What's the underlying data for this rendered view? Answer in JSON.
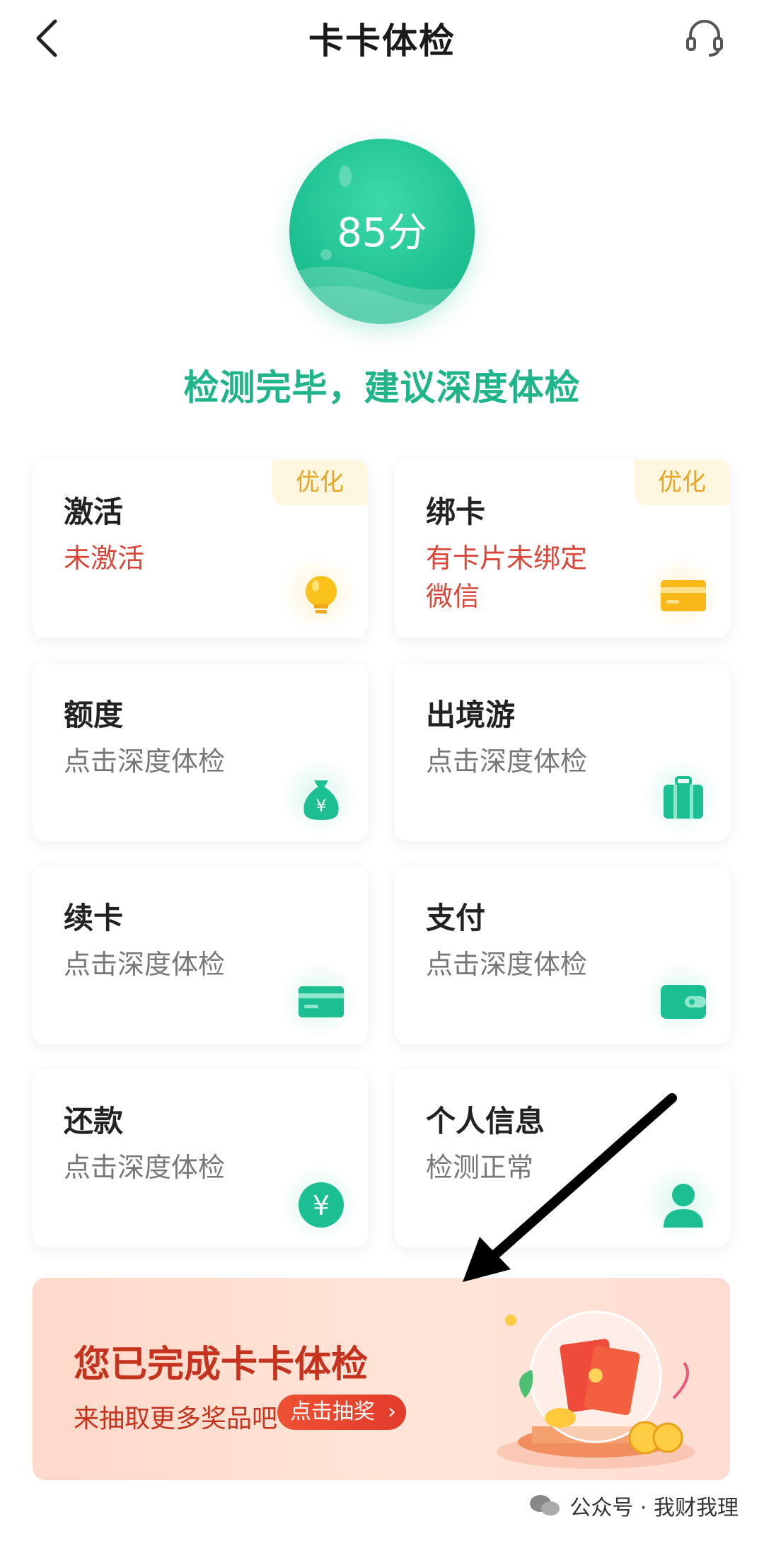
{
  "header": {
    "title": "卡卡体检"
  },
  "score": {
    "text": "85分"
  },
  "status": {
    "message": "检测完毕，建议深度体检"
  },
  "cards": [
    {
      "title": "激活",
      "subtitle": "未激活",
      "badge": "优化",
      "icon": "lightbulb-icon"
    },
    {
      "title": "绑卡",
      "subtitle": "有卡片未绑定微信",
      "badge": "优化",
      "icon": "card-icon"
    },
    {
      "title": "额度",
      "subtitle": "点击深度体检",
      "icon": "money-bag-icon"
    },
    {
      "title": "出境游",
      "subtitle": "点击深度体检",
      "icon": "suitcase-icon"
    },
    {
      "title": "续卡",
      "subtitle": "点击深度体检",
      "icon": "card-icon"
    },
    {
      "title": "支付",
      "subtitle": "点击深度体检",
      "icon": "wallet-icon"
    },
    {
      "title": "还款",
      "subtitle": "点击深度体检",
      "icon": "yuan-coin-icon"
    },
    {
      "title": "个人信息",
      "subtitle": "检测正常",
      "icon": "person-icon"
    }
  ],
  "banner": {
    "title": "您已完成卡卡体检",
    "subtitle": "来抽取更多奖品吧",
    "button_label": "点击抽奖"
  },
  "watermark": {
    "text": "公众号 · 我财我理"
  },
  "colors": {
    "accent": "#20c394",
    "warning": "#d9463a",
    "badge": "#e8a524",
    "banner_text": "#c5331e"
  }
}
